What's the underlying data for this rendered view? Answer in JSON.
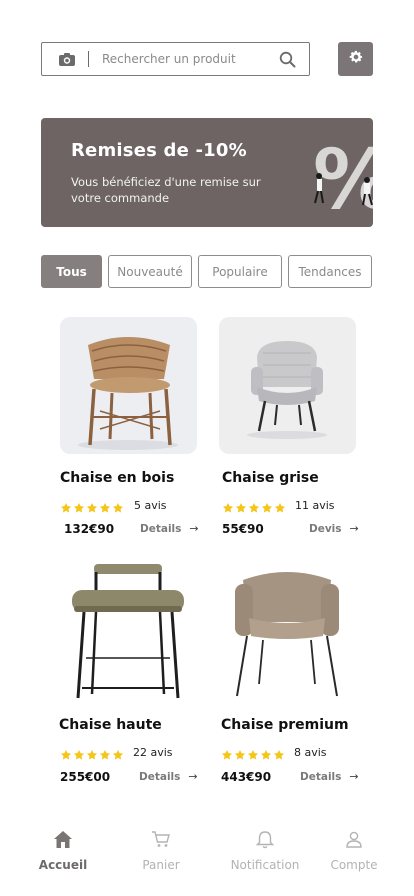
{
  "search": {
    "placeholder": "Rechercher un produit"
  },
  "promo": {
    "title": "Remises de -10%",
    "subtitle": "Vous bénéficiez d'une remise sur votre commande"
  },
  "tabs": [
    {
      "label": "Tous",
      "active": true
    },
    {
      "label": "Nouveauté",
      "active": false
    },
    {
      "label": "Populaire",
      "active": false
    },
    {
      "label": "Tendances",
      "active": false
    }
  ],
  "products": [
    {
      "name": "Chaise en bois",
      "rating": 5,
      "reviews": "5 avis",
      "price": "132€90",
      "details": "Details"
    },
    {
      "name": "Chaise grise",
      "rating": 5,
      "reviews": "11 avis",
      "price": "55€90",
      "details": "Devis"
    },
    {
      "name": "Chaise haute",
      "rating": 5,
      "reviews": "22 avis",
      "price": "255€00",
      "details": "Details"
    },
    {
      "name": "Chaise premium",
      "rating": 5,
      "reviews": "8 avis",
      "price": "443€90",
      "details": "Details"
    }
  ],
  "nav": [
    {
      "label": "Accueil",
      "icon": "home-icon",
      "active": true
    },
    {
      "label": "Panier",
      "icon": "cart-icon",
      "active": false
    },
    {
      "label": "Notification",
      "icon": "bell-icon",
      "active": false
    },
    {
      "label": "Compte",
      "icon": "user-icon",
      "active": false
    }
  ],
  "colors": {
    "accent": "#857f80",
    "promo_bg": "#6e6464",
    "star": "#f5c518"
  }
}
